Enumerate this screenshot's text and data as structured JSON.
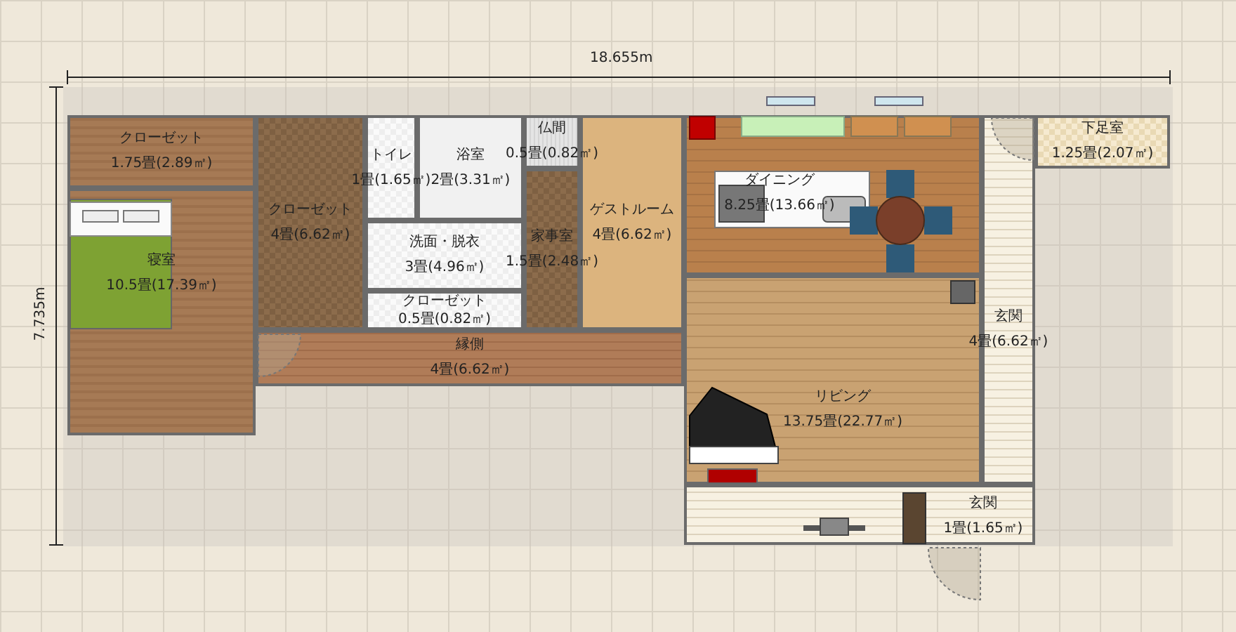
{
  "dimensions": {
    "width": "18.655m",
    "depth": "7.735m"
  },
  "rooms": [
    {
      "name": "クローゼット",
      "area": "1.75畳(2.89㎡)",
      "kind": "wood"
    },
    {
      "name": "寝室",
      "area": "10.5畳(17.39㎡)",
      "kind": "wood"
    },
    {
      "name": "クローゼット",
      "area": "4畳(6.62㎡)",
      "kind": "darkcheck"
    },
    {
      "name": "トイレ",
      "area": "1畳(1.65㎡)",
      "kind": "whitecheck"
    },
    {
      "name": "浴室",
      "area": "2畳(3.31㎡)",
      "kind": "plain"
    },
    {
      "name": "仏間",
      "area": "0.5畳(0.82㎡)",
      "kind": "stripe"
    },
    {
      "name": "家事室",
      "area": "1.5畳(2.48㎡)",
      "kind": "darkcheck"
    },
    {
      "name": "ゲストルーム",
      "area": "4畳(6.62㎡)",
      "kind": "lightwood"
    },
    {
      "name": "洗面・脱衣",
      "area": "3畳(4.96㎡)",
      "kind": "whitecheck"
    },
    {
      "name": "クローゼット",
      "area": "0.5畳(0.82㎡)",
      "kind": "whitecheck"
    },
    {
      "name": "縁側",
      "area": "4畳(6.62㎡)",
      "kind": "boards"
    },
    {
      "name": "ダイニング",
      "area": "8.25畳(13.66㎡)",
      "kind": "brick"
    },
    {
      "name": "下足室",
      "area": "1.25畳(2.07㎡)",
      "kind": "beigecheck"
    },
    {
      "name": "玄関",
      "area": "4畳(6.62㎡)",
      "kind": "tile"
    },
    {
      "name": "リビング",
      "area": "13.75畳(22.77㎡)",
      "kind": "lightbrick"
    },
    {
      "name": "玄関",
      "area": "1畳(1.65㎡)",
      "kind": "tile"
    }
  ]
}
